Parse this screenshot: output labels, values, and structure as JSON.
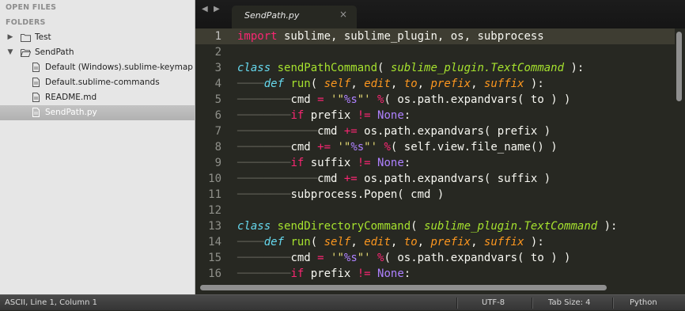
{
  "sidebar": {
    "open_files_header": "OPEN FILES",
    "folders_header": "FOLDERS",
    "folders": [
      {
        "label": "Test",
        "expanded": false
      },
      {
        "label": "SendPath",
        "expanded": true
      }
    ],
    "files": [
      {
        "label": "Default (Windows).sublime-keymap"
      },
      {
        "label": "Default.sublime-commands"
      },
      {
        "label": "README.md"
      },
      {
        "label": "SendPath.py",
        "selected": true
      }
    ]
  },
  "tabs": {
    "prev_icon": "caret-left-icon",
    "next_icon": "caret-right-icon",
    "active_tab": "SendPath.py",
    "close_glyph": "×"
  },
  "editor": {
    "current_line": 1,
    "lines": [
      {
        "n": "1"
      },
      {
        "n": "2"
      },
      {
        "n": "3"
      },
      {
        "n": "4"
      },
      {
        "n": "5"
      },
      {
        "n": "6"
      },
      {
        "n": "7"
      },
      {
        "n": "8"
      },
      {
        "n": "9"
      },
      {
        "n": "10"
      },
      {
        "n": "11"
      },
      {
        "n": "12"
      },
      {
        "n": "13"
      },
      {
        "n": "14"
      },
      {
        "n": "15"
      },
      {
        "n": "16"
      }
    ]
  },
  "status": {
    "position": "ASCII, Line 1, Column 1",
    "encoding": "UTF-8",
    "tab_size": "Tab Size: 4",
    "syntax": "Python"
  },
  "colors": {
    "editor_bg": "#272822",
    "keyword": "#f92672",
    "storage": "#66d9ef",
    "function": "#a6e22e",
    "parameter": "#fd971f",
    "string": "#e6db74",
    "format": "#ae81ff",
    "sidebar_bg": "#e6e6e6"
  }
}
